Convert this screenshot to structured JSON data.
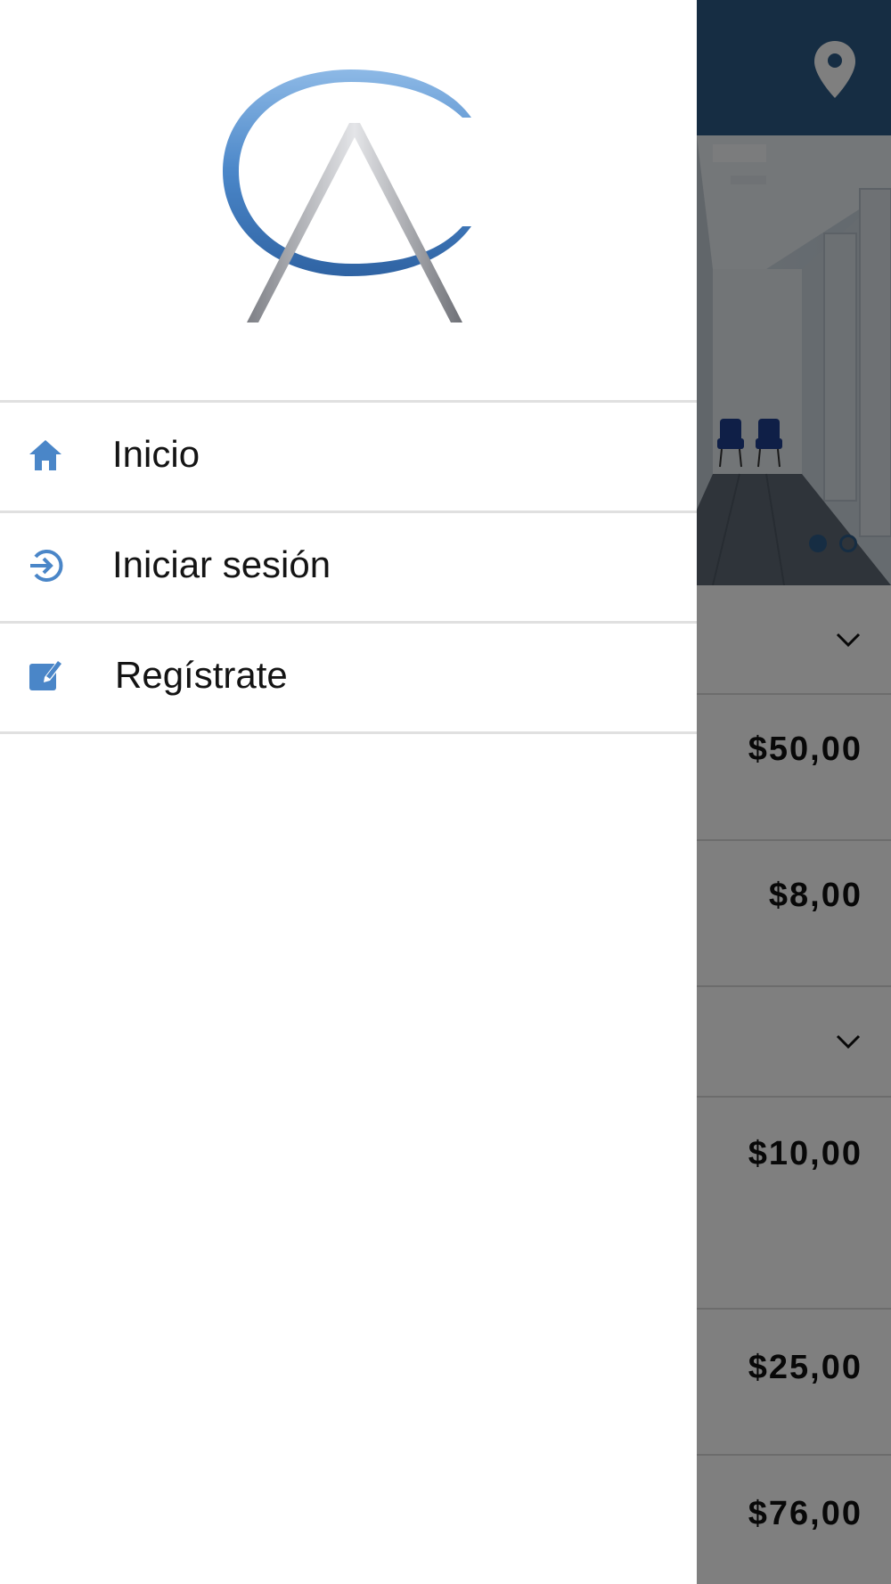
{
  "header": {
    "location_icon": "map-marker-icon",
    "bar_color": "#2d5b86"
  },
  "carousel": {
    "image": "clinic-hallway-photo",
    "slides": 2,
    "active_slide": 1
  },
  "price_list": {
    "prices": [
      "$50,00",
      "$8,00",
      "$10,00",
      "$25,00",
      "$76,00"
    ]
  },
  "drawer": {
    "logo": "CA monogram logo",
    "items": [
      {
        "label": "Inicio",
        "icon": "home-icon"
      },
      {
        "label": "Iniciar sesión",
        "icon": "login-icon"
      },
      {
        "label": "Regístrate",
        "icon": "edit-icon"
      }
    ],
    "accent_color": "#4a86c8"
  }
}
